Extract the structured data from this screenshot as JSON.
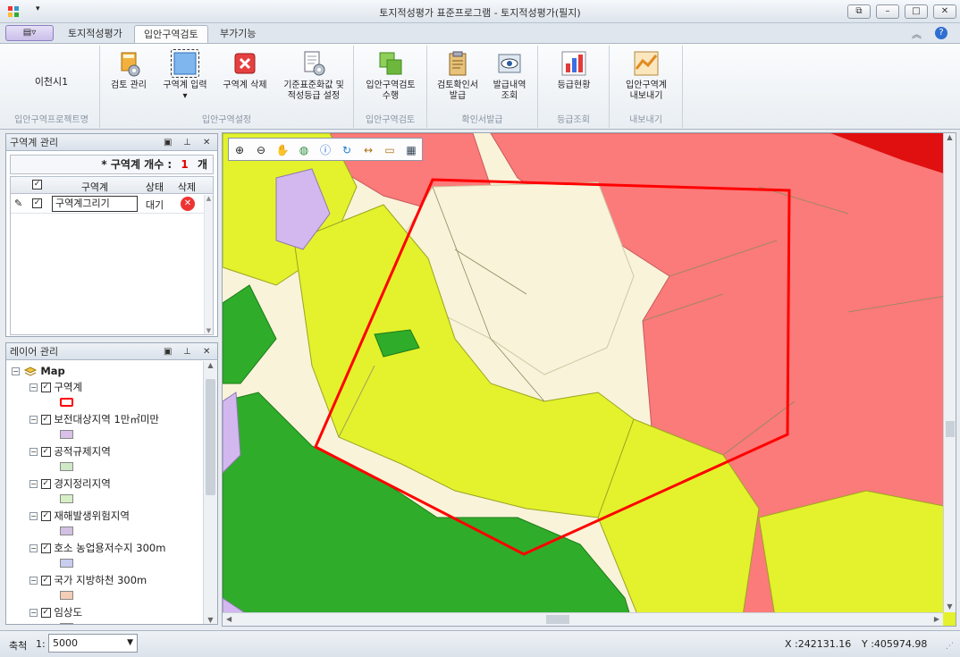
{
  "window": {
    "title": "토지적성평가 표준프로그램 - 토지적성평가(필지)"
  },
  "tabs": {
    "t1": "토지적성평가",
    "t2": "입안구역검토",
    "t3": "부가기능"
  },
  "ribbon": {
    "project_name": "이천시1",
    "project_group": "입안구역프로젝트명",
    "btn_review_manage": "검토 관리",
    "btn_zone_input_1": "구역계 입력",
    "btn_zone_input_arrow": "▾",
    "btn_zone_delete": "구역계 삭제",
    "btn_standard_1": "기준표준화값 및",
    "btn_standard_2": "적성등급 설정",
    "group_setup": "입안구역설정",
    "btn_run_1": "입안구역검토",
    "btn_run_2": "수행",
    "group_review": "입안구역검토",
    "btn_cert_issue_1": "검토확인서",
    "btn_cert_issue_2": "발급",
    "btn_cert_list_1": "발급내역",
    "btn_cert_list_2": "조회",
    "group_cert": "확인서발급",
    "btn_grade": "등급현황",
    "group_grade": "등급조회",
    "btn_export_1": "입안구역계",
    "btn_export_2": "내보내기",
    "group_export": "내보내기"
  },
  "zone_panel": {
    "title": "구역계 관리",
    "count_label": "* 구역계 개수 :",
    "count_value": "1",
    "count_unit": "개",
    "col_zone": "구역계",
    "col_status": "상태",
    "col_delete": "삭제",
    "rows": [
      {
        "name": "구역계그리기",
        "status": "대기",
        "checked": true
      }
    ]
  },
  "layer_panel": {
    "title": "레이어 관리",
    "root": "Map",
    "layers": [
      {
        "name": "구역계",
        "color": "#ff0000"
      },
      {
        "name": "보전대상지역 1만㎡미만",
        "color": "#d8c0e8"
      },
      {
        "name": "공적규제지역",
        "color": "#cfe8c8"
      },
      {
        "name": "경지정리지역",
        "color": "#d6efc6"
      },
      {
        "name": "재해발생위험지역",
        "color": "#d2c0e2"
      },
      {
        "name": "호소 농업용저수지 300m",
        "color": "#c8cdf0"
      },
      {
        "name": "국가 지방하천 300m",
        "color": "#f3cdb5"
      },
      {
        "name": "임상도",
        "color": "#cccccc"
      }
    ]
  },
  "map": {
    "colors": {
      "cream": "#f9f3d9",
      "yellow": "#e3f22c",
      "green": "#2fad2a",
      "red": "#fb7a7a",
      "darkred": "#e01010",
      "purple": "#d2b8ee",
      "boundary": "#ff0000"
    },
    "tool_icons": [
      "zoom-in-icon",
      "zoom-out-icon",
      "pan-hand-icon",
      "globe-icon",
      "info-icon",
      "refresh-icon",
      "measure-distance-icon",
      "measure-area-icon",
      "layer-view-icon"
    ]
  },
  "status": {
    "scale_label": "축척",
    "scale_prefix": "1:",
    "scale_value": "5000",
    "coord_x": "X :242131.16",
    "coord_y": "Y :405974.98"
  }
}
